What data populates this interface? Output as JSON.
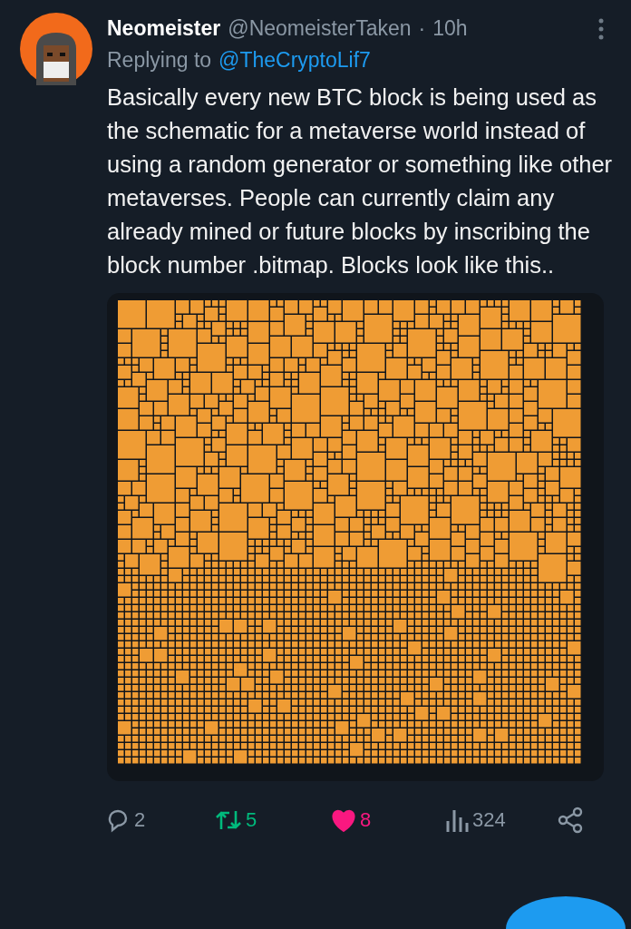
{
  "tweet": {
    "author_name": "Neomeister",
    "handle": "@NeomeisterTaken",
    "separator": "·",
    "time": "10h",
    "replying_label": "Replying to",
    "replying_to": "@TheCryptoLif7",
    "text": "Basically every new BTC block is being used as the schematic for a metaverse world instead of using a random generator or something like other metaverses. People can currently claim any already mined or future blocks by inscribing the block number .bitmap. Blocks look like this..",
    "actions": [
      {
        "kind": "reply",
        "count": "2",
        "selected": false
      },
      {
        "kind": "retweet",
        "count": "5",
        "selected": true
      },
      {
        "kind": "like",
        "count": "8",
        "selected": true
      },
      {
        "kind": "views",
        "count": "324",
        "selected": false
      },
      {
        "kind": "share",
        "selected": false
      }
    ]
  }
}
